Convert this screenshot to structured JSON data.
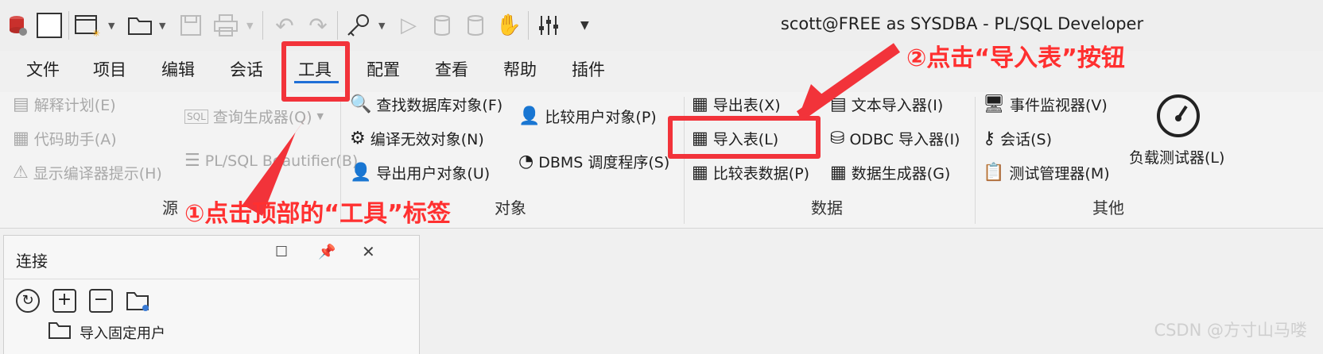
{
  "window": {
    "title": "scott@FREE as SYSDBA - PL/SQL Developer"
  },
  "menu": [
    "文件",
    "项目",
    "编辑",
    "会话",
    "工具",
    "配置",
    "查看",
    "帮助",
    "插件"
  ],
  "ribbon": {
    "source": {
      "group_label": "源",
      "explain_plan": "解释计划(E)",
      "code_assistant": "代码助手(A)",
      "compiler_hints": "显示编译器提示(H)",
      "query_builder": "查询生成器(Q)",
      "beautifier": "PL/SQL Beautifier(B)"
    },
    "objects": {
      "group_label": "对象",
      "find_db_objects": "查找数据库对象(F)",
      "compile_invalid": "编译无效对象(N)",
      "export_user_objects": "导出用户对象(U)",
      "compare_user_objects": "比较用户对象(P)",
      "dbms_scheduler": "DBMS 调度程序(S)"
    },
    "data": {
      "group_label": "数据",
      "export_tables": "导出表(X)",
      "import_tables": "导入表(L)",
      "compare_table_data": "比较表数据(P)",
      "text_importer": "文本导入器(I)",
      "odbc_importer": "ODBC 导入器(I)",
      "data_generator": "数据生成器(G)"
    },
    "other": {
      "group_label": "其他",
      "event_monitor": "事件监视器(V)",
      "sessions": "会话(S)",
      "test_manager": "测试管理器(M)",
      "load_tester": "负载测试器(L)"
    }
  },
  "connection_panel": {
    "title": "连接",
    "tree_items": [
      "导入固定用户"
    ]
  },
  "annotations": {
    "step1": "①点击顶部的“工具”标签",
    "step2": "②点击“导入表”按钮"
  },
  "watermark": "CSDN @方寸山马喽",
  "colors": {
    "annotation_red": "#f2333a",
    "active_tab_underline": "#1f6fd6"
  },
  "active_menu": "工具"
}
